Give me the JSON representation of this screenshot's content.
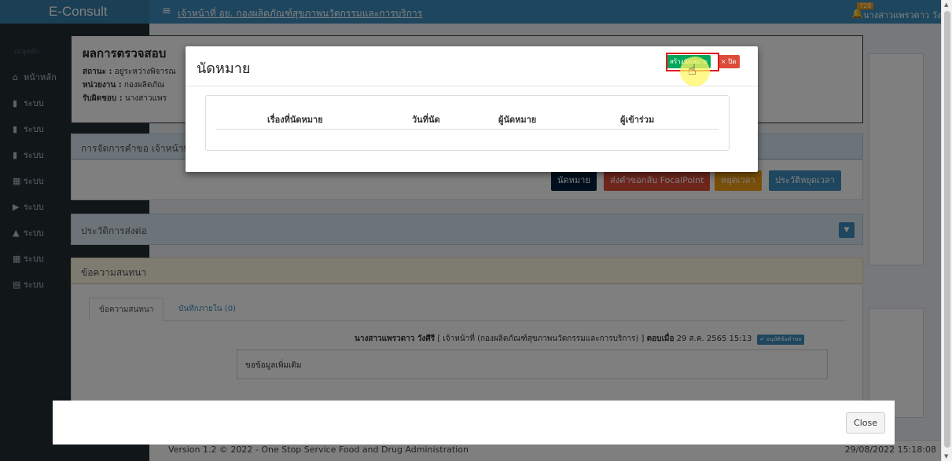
{
  "app": {
    "logo": "E-Consult",
    "menu_icon": "hamburger-icon",
    "title": "เจ้าหน้าที่ อย. กองผลิตภัณฑ์สุขภาพนวัตกรรมและการบริการ",
    "notification_count": "728",
    "user": "นางสาวแพรวดาว วังศีรี"
  },
  "sidebar": {
    "header": "เมนูหลัก",
    "items": [
      {
        "icon": "home-icon",
        "label": "หน้าหลัก"
      },
      {
        "icon": "book-icon",
        "label": "ระบบ"
      },
      {
        "icon": "book-icon",
        "label": "ระบบ"
      },
      {
        "icon": "book-icon",
        "label": "ระบบ"
      },
      {
        "icon": "calendar-icon",
        "label": "ระบบ"
      },
      {
        "icon": "video-icon",
        "label": "ระบบ"
      },
      {
        "icon": "graduation-cap-icon",
        "label": "ระบบ"
      },
      {
        "icon": "calendar-icon",
        "label": "ระบบ"
      },
      {
        "icon": "document-icon",
        "label": "ระบบ"
      }
    ]
  },
  "result": {
    "title": "ผลการตรวจสอบ",
    "status_label": "สถานะ :",
    "status_value": "อยู่ระหว่างพิจารณ",
    "agency_label": "หน่วยงาน :",
    "agency_value": "กองผลิตภัณ",
    "owner_label": "รับผิดชอบ :",
    "owner_value": "นางสาวแพร"
  },
  "manage": {
    "title": "การจัดการคำขอ เจ้าหน้าที่",
    "buttons": {
      "appointment": "นัดหมาย",
      "send_back": "ส่งคำขอกลับ FocalPoint",
      "pause": "หยุดเวลา",
      "pause_history": "ประวัติหยุดเวลา"
    }
  },
  "history": {
    "title": "ประวัติการส่งต่อ"
  },
  "chat": {
    "title": "ข้อความสนทนา",
    "tabs": [
      "ข้อความสนทนา",
      "บันทึกภายใน (0)"
    ],
    "message": {
      "author": "นางสาวแพรวดาว วังศีรี",
      "role": "[ เจ้าหน้าที่ (กองผลิตภัณฑ์สุขภาพนวัตกรรมและการบริการ) ]",
      "reply_label": "ตอบเมื่อ",
      "timestamp": "29 ส.ค. 2565 15:13",
      "badge": "✔ อนุมัติข้อคำขอ",
      "text": "ขอข้อมูลเพิ่มเติม"
    }
  },
  "footer": {
    "version": "Version 1.2 © 2022 - One Stop Service Food and Drug Administration",
    "datetime": "29/08/2022 15:18:08"
  },
  "modal": {
    "title": "นัดหมาย",
    "create_button": "สร้างนัดหมาย",
    "close_button": "× ปิด",
    "columns": [
      "เรื่องที่นัดหมาย",
      "วันที่นัด",
      "ผู้นัดหมาย",
      "ผู้เข้าร่วม"
    ]
  },
  "outer_modal": {
    "close_button": "Close"
  },
  "colors": {
    "primary": "#3c8dbc",
    "success": "#00a65a",
    "danger": "#dd4b39",
    "warning": "#f39c12",
    "navy": "#001f3f",
    "highlight": "#e21b1b"
  }
}
